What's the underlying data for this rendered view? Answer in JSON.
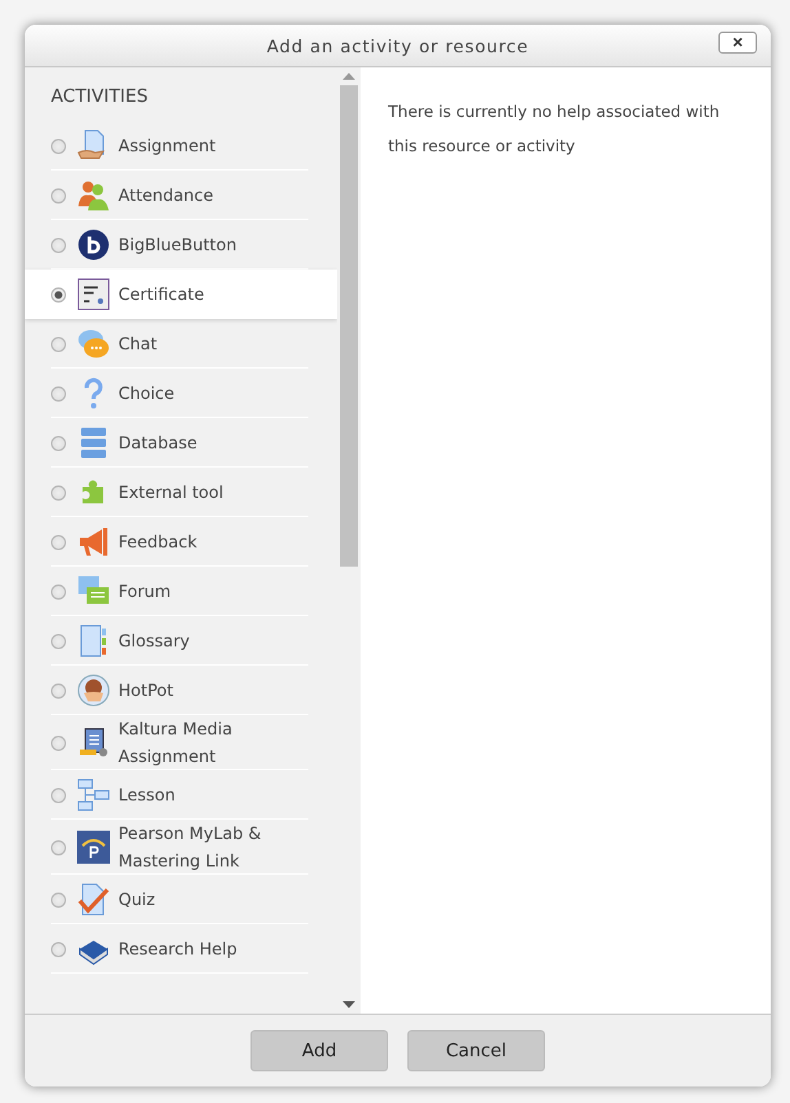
{
  "dialog": {
    "title": "Add an activity or resource",
    "close": "×"
  },
  "activities": {
    "heading": "ACTIVITIES",
    "items": [
      {
        "label": "Assignment",
        "selected": false
      },
      {
        "label": "Attendance",
        "selected": false
      },
      {
        "label": "BigBlueButton",
        "selected": false
      },
      {
        "label": "Certificate",
        "selected": true
      },
      {
        "label": "Chat",
        "selected": false
      },
      {
        "label": "Choice",
        "selected": false
      },
      {
        "label": "Database",
        "selected": false
      },
      {
        "label": "External tool",
        "selected": false
      },
      {
        "label": "Feedback",
        "selected": false
      },
      {
        "label": "Forum",
        "selected": false
      },
      {
        "label": "Glossary",
        "selected": false
      },
      {
        "label": "HotPot",
        "selected": false
      },
      {
        "label": "Kaltura Media Assignment",
        "selected": false
      },
      {
        "label": "Lesson",
        "selected": false
      },
      {
        "label": "Pearson MyLab & Mastering Link",
        "selected": false
      },
      {
        "label": "Quiz",
        "selected": false
      },
      {
        "label": "Research Help",
        "selected": false
      }
    ]
  },
  "help": {
    "text": "There is currently no help associated with this resource or activity"
  },
  "buttons": [
    "Add",
    "Cancel"
  ]
}
